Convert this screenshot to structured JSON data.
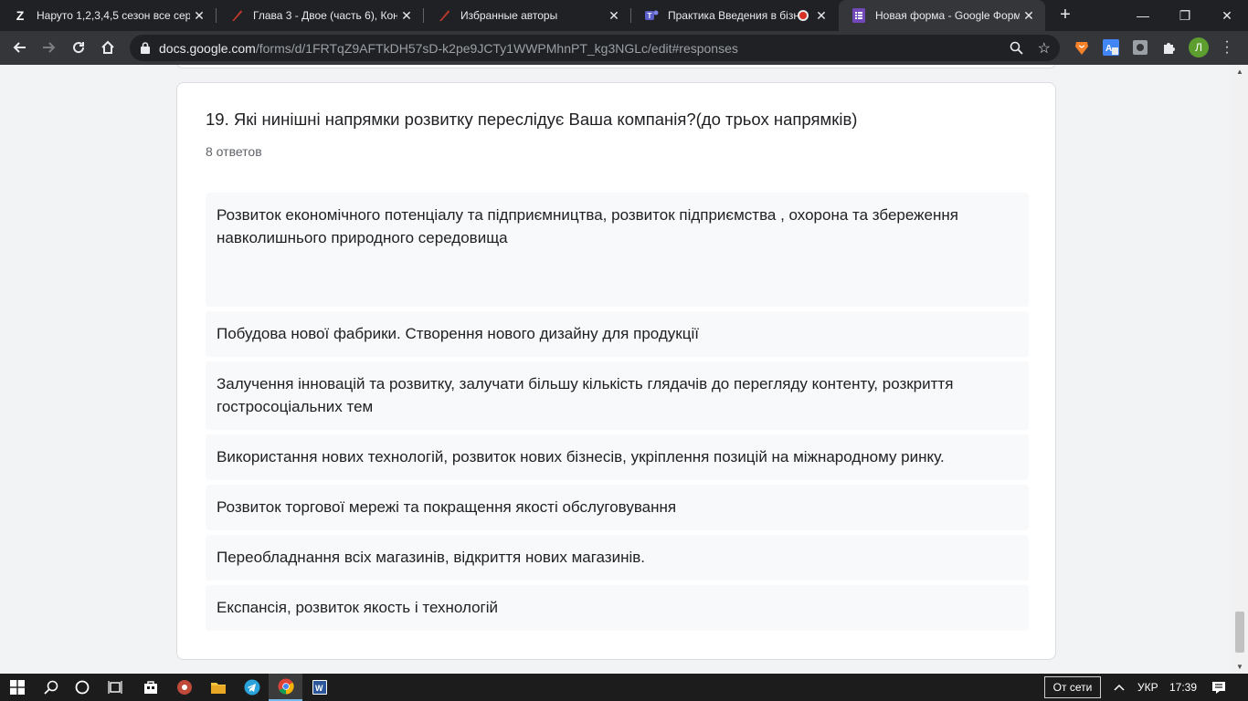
{
  "browser": {
    "tabs": [
      {
        "title": "Наруто 1,2,3,4,5 сезон все сер",
        "icon": "z-icon"
      },
      {
        "title": "Глава 3 - Двое (часть 6), Конт",
        "icon": "quill-icon"
      },
      {
        "title": "Избранные авторы",
        "icon": "quill-icon"
      },
      {
        "title": "Практика Введения в бізн",
        "icon": "teams-icon"
      },
      {
        "title": "Новая форма - Google Формы",
        "icon": "forms-icon"
      }
    ],
    "url_host": "docs.google.com",
    "url_path": "/forms/d/1FRTqZ9AFTkDH57sD-k2pe9JCTy1WWPMhnPT_kg3NGLc/edit#responses",
    "profile_initial": "Л"
  },
  "question": {
    "title": "19. Які нинішні напрямки розвитку переслідує Ваша компанія?(до трьох напрямків)",
    "count": "8 ответов",
    "answers": [
      "Розвиток економічного потенціалу та підприємництва, розвиток підприємства , охорона та збереження навколишнього природного середовища",
      "Побудова нової фабрики. Створення нового дизайну для продукції",
      "Залучення інновацій та розвитку, залучати більшу кількість глядачів до перегляду контенту, розкриття гостросоціальних тем",
      "Використання нових технологій, розвиток нових бізнесів, укріплення позицій на міжнародному ринку.",
      "Розвиток торгової мережі та покращення якості обслуговування",
      "Переобладнання всіх магазинів, відкриття нових магазинів.",
      "Експансія, розвиток якость і технологій"
    ]
  },
  "help_label": "?",
  "taskbar": {
    "network_status": "От сети",
    "language": "УКР",
    "time": "17:39"
  },
  "colors": {
    "accent": "#673ab7",
    "tab_active": "#35363a",
    "tab_bar": "#202124"
  }
}
